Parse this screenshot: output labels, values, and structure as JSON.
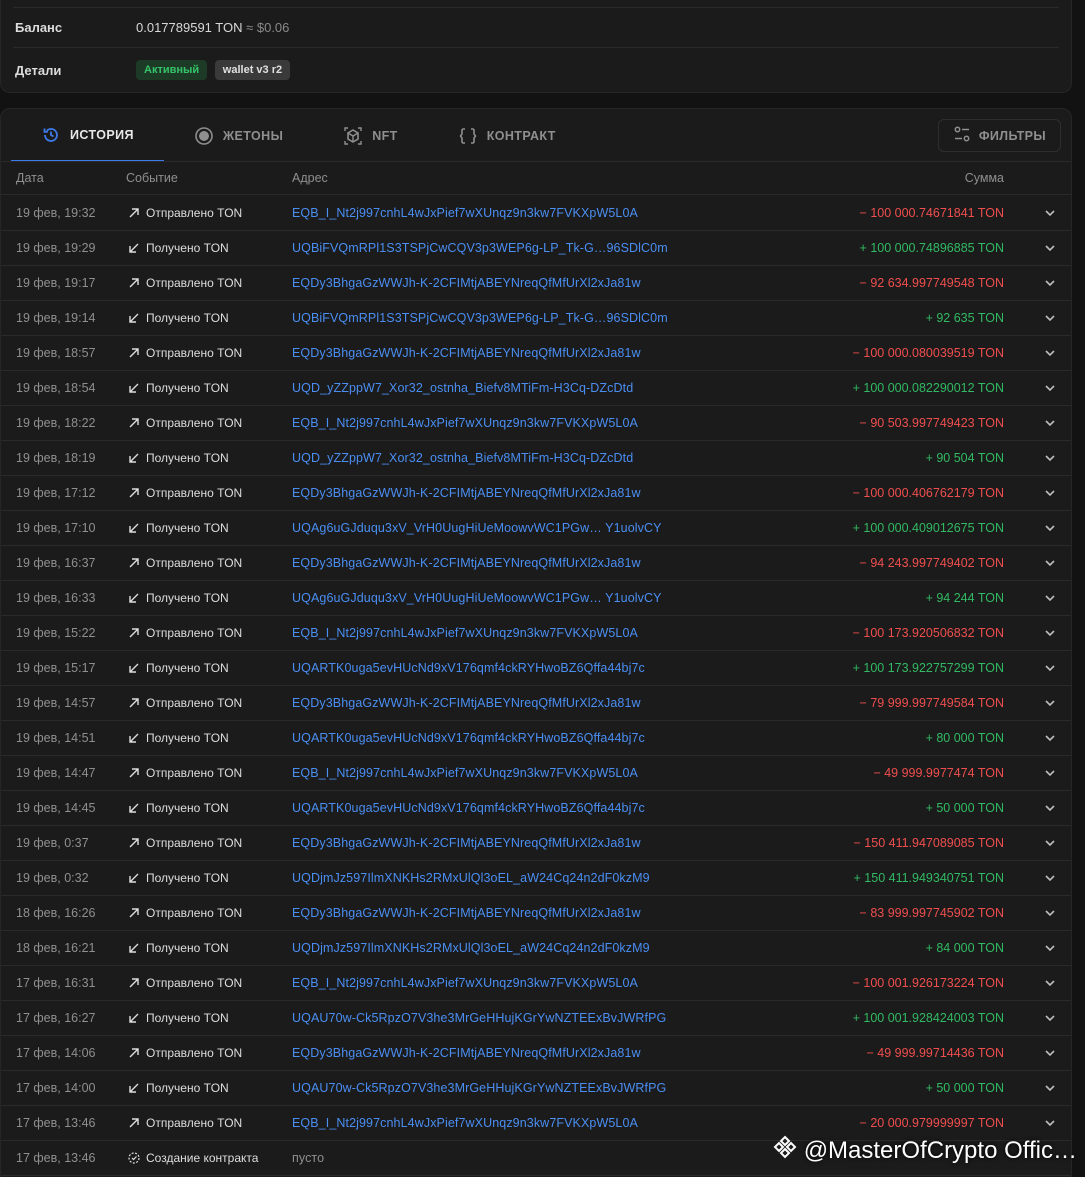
{
  "details": {
    "balance_label": "Баланс",
    "balance_value": "0.017789591 TON",
    "balance_usd": " ≈ $0.06",
    "details_label": "Детали",
    "status_badge": "Активный",
    "version_badge": "wallet v3 r2"
  },
  "tabs": [
    {
      "label": "ИСТОРИЯ",
      "icon": "history-icon",
      "active": true
    },
    {
      "label": "ЖЕТОНЫ",
      "icon": "coin-icon",
      "active": false
    },
    {
      "label": "NFT",
      "icon": "cube-icon",
      "active": false
    },
    {
      "label": "КОНТРАКТ",
      "icon": "code-braces-icon",
      "active": false
    }
  ],
  "filters_label": "ФИЛЬТРЫ",
  "table": {
    "headers": {
      "date": "Дата",
      "event": "Событие",
      "address": "Адрес",
      "amount": "Сумма"
    },
    "rows": [
      {
        "date": "19 фев, 19:32",
        "event": "Отправлено TON",
        "dir": "out",
        "address": "EQB_I_Nt2j997cnhL4wJxPief7wXUnqz9n3kw7FVKXpW5L0A",
        "amount": "− 100 000.74671841 TON"
      },
      {
        "date": "19 фев, 19:29",
        "event": "Получено TON",
        "dir": "in",
        "address": "UQBiFVQmRPl1S3TSPjCwCQV3p3WEP6g-LP_Tk-G…96SDlC0m",
        "amount": "+ 100 000.74896885 TON"
      },
      {
        "date": "19 фев, 19:17",
        "event": "Отправлено TON",
        "dir": "out",
        "address": "EQDy3BhgaGzWWJh-K-2CFIMtjABEYNreqQfMfUrXl2xJa81w",
        "amount": "− 92 634.997749548 TON"
      },
      {
        "date": "19 фев, 19:14",
        "event": "Получено TON",
        "dir": "in",
        "address": "UQBiFVQmRPl1S3TSPjCwCQV3p3WEP6g-LP_Tk-G…96SDlC0m",
        "amount": "+ 92 635 TON"
      },
      {
        "date": "19 фев, 18:57",
        "event": "Отправлено TON",
        "dir": "out",
        "address": "EQDy3BhgaGzWWJh-K-2CFIMtjABEYNreqQfMfUrXl2xJa81w",
        "amount": "− 100 000.080039519 TON"
      },
      {
        "date": "19 фев, 18:54",
        "event": "Получено TON",
        "dir": "in",
        "address": "UQD_yZZppW7_Xor32_ostnha_Biefv8MTiFm-H3Cq-DZcDtd",
        "amount": "+ 100 000.082290012 TON"
      },
      {
        "date": "19 фев, 18:22",
        "event": "Отправлено TON",
        "dir": "out",
        "address": "EQB_I_Nt2j997cnhL4wJxPief7wXUnqz9n3kw7FVKXpW5L0A",
        "amount": "− 90 503.997749423 TON"
      },
      {
        "date": "19 фев, 18:19",
        "event": "Получено TON",
        "dir": "in",
        "address": "UQD_yZZppW7_Xor32_ostnha_Biefv8MTiFm-H3Cq-DZcDtd",
        "amount": "+ 90 504 TON"
      },
      {
        "date": "19 фев, 17:12",
        "event": "Отправлено TON",
        "dir": "out",
        "address": "EQDy3BhgaGzWWJh-K-2CFIMtjABEYNreqQfMfUrXl2xJa81w",
        "amount": "− 100 000.406762179 TON"
      },
      {
        "date": "19 фев, 17:10",
        "event": "Получено TON",
        "dir": "in",
        "address": "UQAg6uGJduqu3xV_VrH0UugHiUeMoowvWC1PGw… Y1uolvCY",
        "amount": "+ 100 000.409012675 TON"
      },
      {
        "date": "19 фев, 16:37",
        "event": "Отправлено TON",
        "dir": "out",
        "address": "EQDy3BhgaGzWWJh-K-2CFIMtjABEYNreqQfMfUrXl2xJa81w",
        "amount": "− 94 243.997749402 TON"
      },
      {
        "date": "19 фев, 16:33",
        "event": "Получено TON",
        "dir": "in",
        "address": "UQAg6uGJduqu3xV_VrH0UugHiUeMoowvWC1PGw… Y1uolvCY",
        "amount": "+ 94 244 TON"
      },
      {
        "date": "19 фев, 15:22",
        "event": "Отправлено TON",
        "dir": "out",
        "address": "EQB_I_Nt2j997cnhL4wJxPief7wXUnqz9n3kw7FVKXpW5L0A",
        "amount": "− 100 173.920506832 TON"
      },
      {
        "date": "19 фев, 15:17",
        "event": "Получено TON",
        "dir": "in",
        "address": "UQARTK0uga5evHUcNd9xV176qmf4ckRYHwoBZ6Qffa44bj7c",
        "amount": "+ 100 173.922757299 TON"
      },
      {
        "date": "19 фев, 14:57",
        "event": "Отправлено TON",
        "dir": "out",
        "address": "EQDy3BhgaGzWWJh-K-2CFIMtjABEYNreqQfMfUrXl2xJa81w",
        "amount": "− 79 999.997749584 TON"
      },
      {
        "date": "19 фев, 14:51",
        "event": "Получено TON",
        "dir": "in",
        "address": "UQARTK0uga5evHUcNd9xV176qmf4ckRYHwoBZ6Qffa44bj7c",
        "amount": "+ 80 000 TON"
      },
      {
        "date": "19 фев, 14:47",
        "event": "Отправлено TON",
        "dir": "out",
        "address": "EQB_I_Nt2j997cnhL4wJxPief7wXUnqz9n3kw7FVKXpW5L0A",
        "amount": "− 49 999.9977474 TON"
      },
      {
        "date": "19 фев, 14:45",
        "event": "Получено TON",
        "dir": "in",
        "address": "UQARTK0uga5evHUcNd9xV176qmf4ckRYHwoBZ6Qffa44bj7c",
        "amount": "+ 50 000 TON"
      },
      {
        "date": "19 фев, 0:37",
        "event": "Отправлено TON",
        "dir": "out",
        "address": "EQDy3BhgaGzWWJh-K-2CFIMtjABEYNreqQfMfUrXl2xJa81w",
        "amount": "− 150 411.947089085 TON"
      },
      {
        "date": "19 фев, 0:32",
        "event": "Получено TON",
        "dir": "in",
        "address": "UQDjmJz597IlmXNKHs2RMxUlQl3oEL_aW24Cq24n2dF0kzM9",
        "amount": "+ 150 411.949340751 TON"
      },
      {
        "date": "18 фев, 16:26",
        "event": "Отправлено TON",
        "dir": "out",
        "address": "EQDy3BhgaGzWWJh-K-2CFIMtjABEYNreqQfMfUrXl2xJa81w",
        "amount": "− 83 999.997745902 TON"
      },
      {
        "date": "18 фев, 16:21",
        "event": "Получено TON",
        "dir": "in",
        "address": "UQDjmJz597IlmXNKHs2RMxUlQl3oEL_aW24Cq24n2dF0kzM9",
        "amount": "+ 84 000 TON"
      },
      {
        "date": "17 фев, 16:31",
        "event": "Отправлено TON",
        "dir": "out",
        "address": "EQB_I_Nt2j997cnhL4wJxPief7wXUnqz9n3kw7FVKXpW5L0A",
        "amount": "− 100 001.926173224 TON"
      },
      {
        "date": "17 фев, 16:27",
        "event": "Получено TON",
        "dir": "in",
        "address": "UQAU70w-Ck5RpzO7V3he3MrGeHHujKGrYwNZTEExBvJWRfPG",
        "amount": "+ 100 001.928424003 TON"
      },
      {
        "date": "17 фев, 14:06",
        "event": "Отправлено TON",
        "dir": "out",
        "address": "EQDy3BhgaGzWWJh-K-2CFIMtjABEYNreqQfMfUrXl2xJa81w",
        "amount": "− 49 999.99714436 TON"
      },
      {
        "date": "17 фев, 14:00",
        "event": "Получено TON",
        "dir": "in",
        "address": "UQAU70w-Ck5RpzO7V3he3MrGeHHujKGrYwNZTEExBvJWRfPG",
        "amount": "+ 50 000 TON"
      },
      {
        "date": "17 фев, 13:46",
        "event": "Отправлено TON",
        "dir": "out",
        "address": "EQB_I_Nt2j997cnhL4wJxPief7wXUnqz9n3kw7FVKXpW5L0A",
        "amount": "− 20 000.979999997 TON"
      },
      {
        "date": "17 фев, 13:46",
        "event": "Создание контракта",
        "dir": "contract",
        "address": "пусто",
        "amount": ""
      }
    ]
  },
  "watermark": "@MasterOfCrypto Offic…",
  "colors": {
    "link": "#4a8ef2",
    "negative": "#f04e4e",
    "positive": "#32b963",
    "accent": "#3e7bea"
  }
}
